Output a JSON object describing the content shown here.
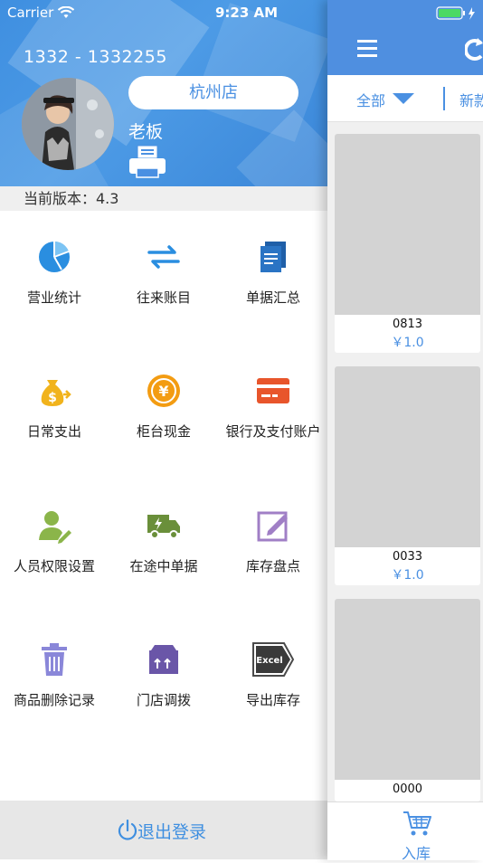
{
  "status_bar": {
    "carrier": "Carrier",
    "time": "9:23 AM"
  },
  "profile": {
    "account": "1332 - 1332255",
    "store": "杭州店",
    "role": "老板",
    "version": "当前版本：4.3"
  },
  "menu": [
    {
      "label": "营业统计",
      "icon": "pie-chart-icon"
    },
    {
      "label": "往来账目",
      "icon": "exchange-arrows-icon"
    },
    {
      "label": "单据汇总",
      "icon": "document-stack-icon"
    },
    {
      "label": "日常支出",
      "icon": "money-bag-icon"
    },
    {
      "label": "柜台现金",
      "icon": "yen-coin-icon"
    },
    {
      "label": "银行及支付账户",
      "icon": "bank-card-icon"
    },
    {
      "label": "人员权限设置",
      "icon": "user-edit-icon"
    },
    {
      "label": "在途中单据",
      "icon": "delivery-truck-icon"
    },
    {
      "label": "库存盘点",
      "icon": "edit-square-icon"
    },
    {
      "label": "商品删除记录",
      "icon": "trash-icon"
    },
    {
      "label": "门店调拨",
      "icon": "transfer-box-icon"
    },
    {
      "label": "导出库存",
      "icon": "excel-export-icon"
    }
  ],
  "logout_label": "退出登录",
  "main": {
    "filter_all": "全部",
    "filter_new": "新款",
    "products": [
      {
        "code": "0813",
        "price": "￥1.0"
      },
      {
        "code": "0033",
        "price": "￥1.0"
      },
      {
        "code": "0000",
        "price": ""
      }
    ],
    "tab_label": "入库"
  },
  "colors": {
    "accent": "#4a90e2",
    "header": "#3f8fe0",
    "nav": "#4f8fe0"
  }
}
